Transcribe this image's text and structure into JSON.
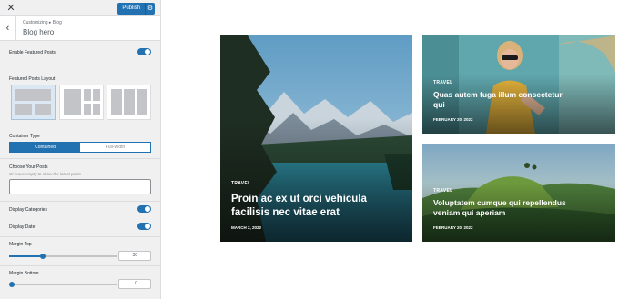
{
  "topbar": {
    "close_glyph": "✕",
    "publish_label": "Publish",
    "settings_glyph": "⚙"
  },
  "section": {
    "back_glyph": "‹",
    "breadcrumb": "Customizing ▸ Blog",
    "title": "Blog hero"
  },
  "controls": {
    "featured_posts": {
      "label": "Enable Featured Posts",
      "enabled": true
    },
    "layout": {
      "label": "Featured Posts Layout",
      "options": [
        "layout-1",
        "layout-2",
        "layout-3"
      ],
      "selected": 0
    },
    "container": {
      "label": "Container Type",
      "options": [
        "Contained",
        "Full-width"
      ],
      "selected": "Contained"
    },
    "choose_posts": {
      "label": "Choose Your Posts",
      "hint": "Or leave empty to show the latest posts",
      "value": ""
    },
    "display_categories": {
      "label": "Display Categories",
      "enabled": true
    },
    "display_date": {
      "label": "Display Date",
      "enabled": true
    },
    "margin_top": {
      "label": "Margin Top",
      "value": "30"
    },
    "margin_bottom": {
      "label": "Margin Bottom",
      "value": "0"
    }
  },
  "posts": [
    {
      "category": "TRAVEL",
      "title_line1": "Proin ac ex ut orci vehicula",
      "title_line2": "facilisis nec vitae erat",
      "date": "MARCH 2, 2022"
    },
    {
      "category": "TRAVEL",
      "title_line1": "Quas autem fuga illum consectetur",
      "title_line2": "qui",
      "date": "FEBRUARY 20, 2022"
    },
    {
      "category": "TRAVEL",
      "title_line1": "Voluptatem cumque qui repellendus",
      "title_line2": "veniam qui aperiam",
      "date": "FEBRUARY 20, 2022"
    }
  ],
  "colors": {
    "accent": "#2271b1",
    "sidebar_bg": "#f0f0f1"
  }
}
